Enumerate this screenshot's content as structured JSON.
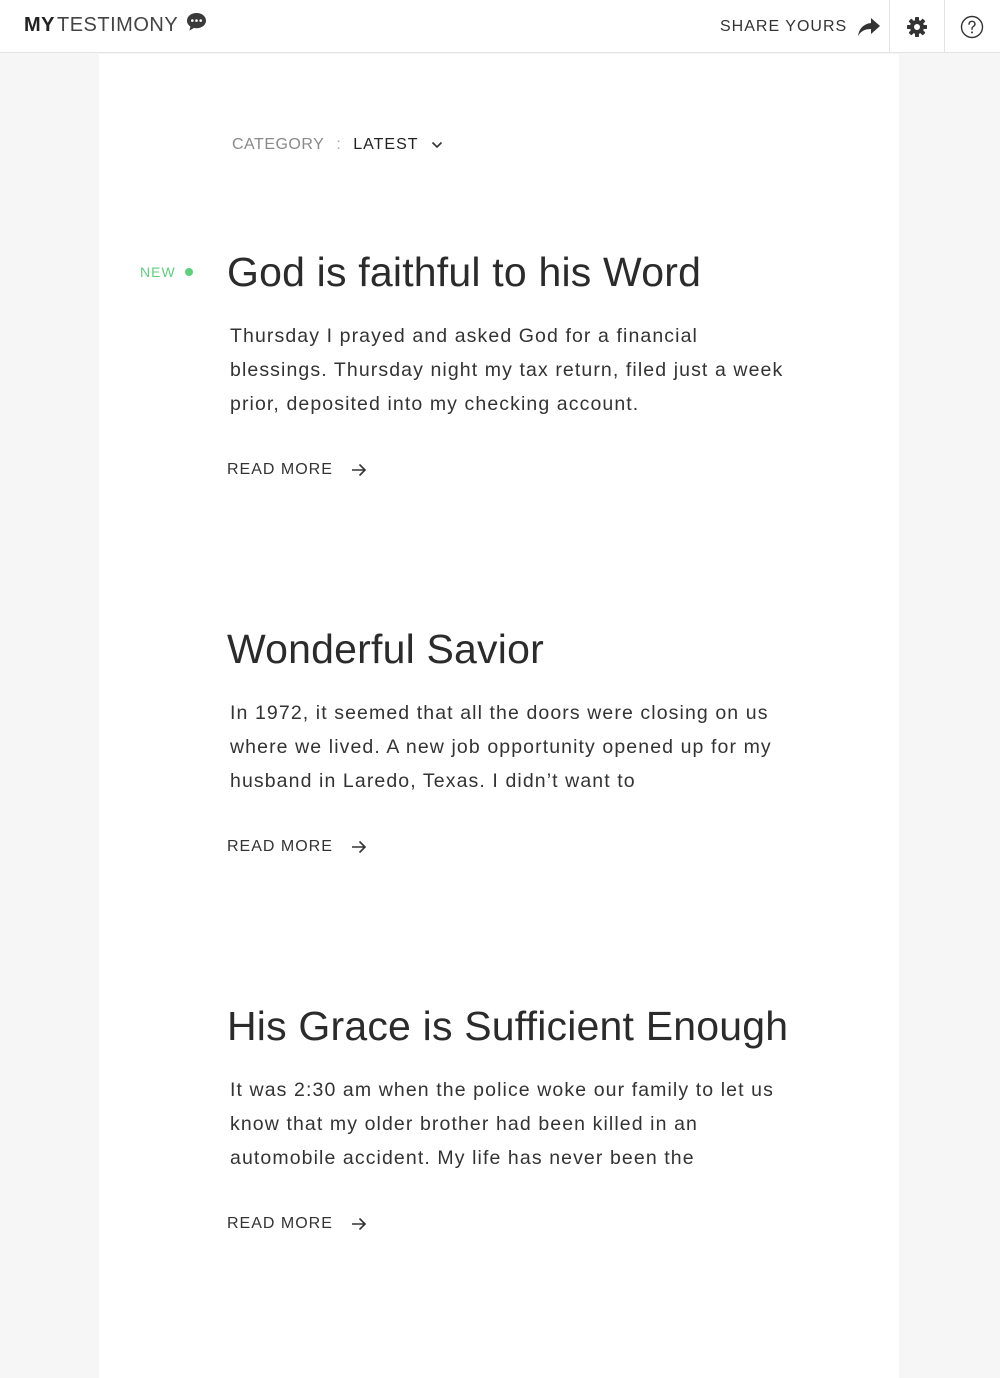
{
  "header": {
    "brand_bold": "MY",
    "brand_rest": "TESTIMONY",
    "share_label": "SHARE YOURS"
  },
  "filter": {
    "label": "CATEGORY",
    "separator": ":",
    "selected": "LATEST"
  },
  "posts": [
    {
      "badge": "NEW",
      "title": "God is faithful to his Word",
      "excerpt": "Thursday I prayed and asked God for a financial blessings. Thursday night my tax return, filed just a week prior, deposited into my checking account.",
      "read_more": "READ MORE"
    },
    {
      "title": "Wonderful Savior",
      "excerpt": "In 1972, it seemed that all the doors were closing on us where we lived. A new job opportunity opened up for my husband in Laredo, Texas. I didn’t want to",
      "read_more": "READ MORE"
    },
    {
      "title": "His Grace is Sufficient Enough",
      "excerpt": "It was 2:30 am when the police woke our family to let us know that my older brother had been killed in an automobile accident. My life has never been the",
      "read_more": "READ MORE"
    }
  ],
  "icons": {
    "brand": "chat-bubble-icon",
    "share": "share-arrow-icon",
    "settings": "gear-icon",
    "help": "help-circle-icon",
    "dropdown": "chevron-down-icon",
    "read_more": "arrow-right-icon"
  },
  "colors": {
    "new_badge": "#5fcf7c",
    "background": "#f6f6f6",
    "card": "#ffffff"
  }
}
